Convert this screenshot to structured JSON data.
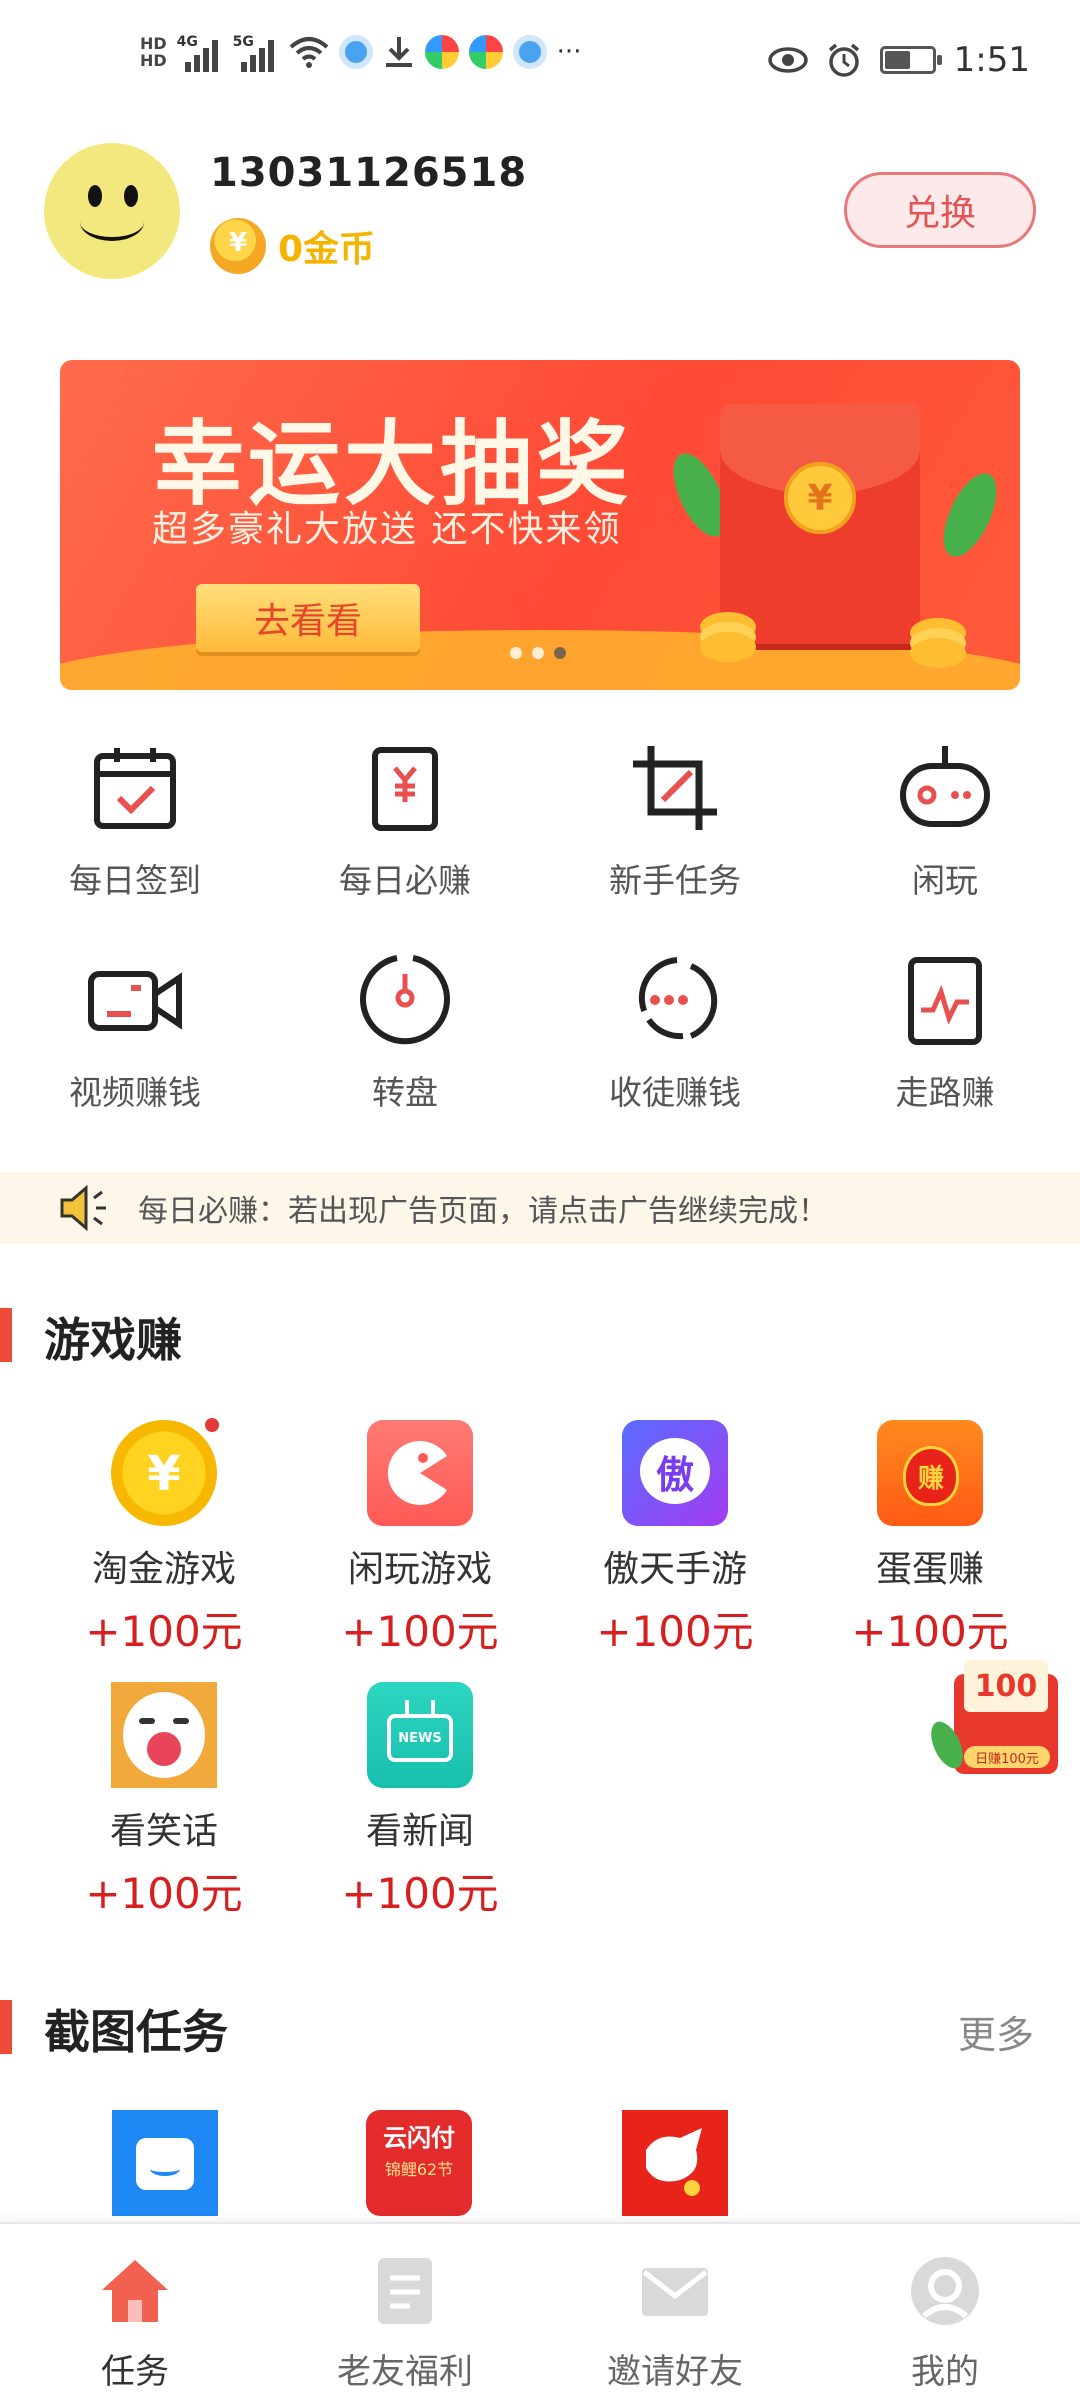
{
  "status_bar": {
    "time": "1:51",
    "network_left": "HD",
    "signal_4g": "4G",
    "signal_5g": "5G",
    "more": "···",
    "battery_level": 0.55
  },
  "profile": {
    "phone": "13031126518",
    "coins": "0金币",
    "exchange_label": "兑换"
  },
  "banner": {
    "title": "幸运大抽奖",
    "subtitle": "超多豪礼大放送 还不快来领",
    "button_label": "去看看",
    "page_count": 3,
    "active_index": 2
  },
  "grid": {
    "items": [
      {
        "label": "每日签到",
        "icon": "calendar-check-icon"
      },
      {
        "label": "每日必赚",
        "icon": "yuan-card-icon"
      },
      {
        "label": "新手任务",
        "icon": "crop-icon"
      },
      {
        "label": "闲玩",
        "icon": "gamepad-icon"
      },
      {
        "label": "视频赚钱",
        "icon": "video-camera-icon"
      },
      {
        "label": "转盘",
        "icon": "wheel-icon"
      },
      {
        "label": "收徒赚钱",
        "icon": "apprentice-icon"
      },
      {
        "label": "走路赚",
        "icon": "pulse-icon"
      }
    ]
  },
  "notice": {
    "text": "每日必赚：若出现广告页面，请点击广告继续完成！"
  },
  "games_section": {
    "title": "游戏赚",
    "items": [
      {
        "name": "淘金游戏",
        "reward": "+100元",
        "icon": "gold-coin-icon"
      },
      {
        "name": "闲玩游戏",
        "reward": "+100元",
        "icon": "pacman-icon"
      },
      {
        "name": "傲天手游",
        "reward": "+100元",
        "icon": "aotian-icon"
      },
      {
        "name": "蛋蛋赚",
        "reward": "+100元",
        "icon": "money-bag-icon"
      },
      {
        "name": "看笑话",
        "reward": "+100元",
        "icon": "laughing-face-icon"
      },
      {
        "name": "看新闻",
        "reward": "+100元",
        "icon": "news-tv-icon"
      }
    ],
    "aotian_glyph": "傲",
    "moneybag_glyph": "赚",
    "news_glyph": "NEWS"
  },
  "floating_badge": {
    "amount": "100",
    "caption": "日赚100元"
  },
  "screenshot_section": {
    "title": "截图任务",
    "more_label": "更多",
    "tile2_text_top": "云闪付",
    "tile2_text_bottom": "锦鲤62节"
  },
  "bottom_nav": {
    "items": [
      {
        "label": "任务",
        "icon": "home-icon",
        "active": true
      },
      {
        "label": "老友福利",
        "icon": "document-icon",
        "active": false
      },
      {
        "label": "邀请好友",
        "icon": "envelope-icon",
        "active": false
      },
      {
        "label": "我的",
        "icon": "user-icon",
        "active": false
      }
    ]
  },
  "colors": {
    "accent_red": "#f04a3b",
    "coin_yellow": "#f5b300",
    "reward_red": "#d81f1f"
  }
}
